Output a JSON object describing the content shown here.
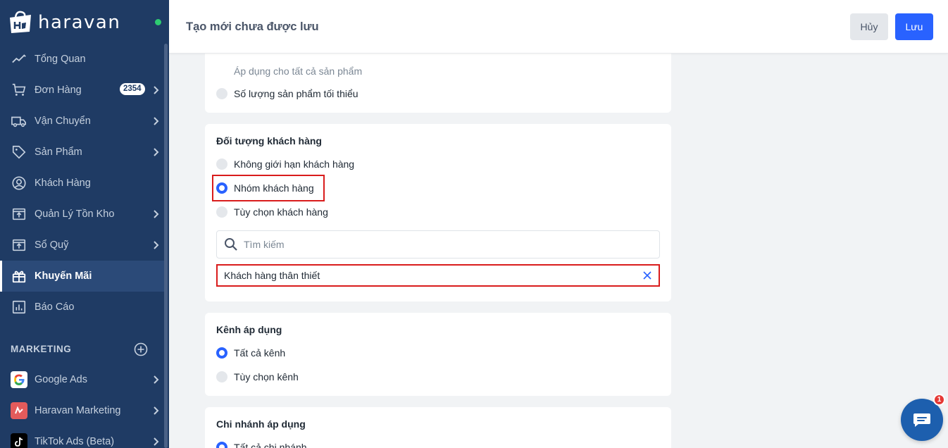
{
  "app": {
    "brand": "haravan"
  },
  "sidebar": {
    "items": [
      {
        "label": "Tổng Quan",
        "icon": "chart-line-icon"
      },
      {
        "label": "Đơn Hàng",
        "icon": "cart-icon",
        "badge": "2354",
        "has_children": true
      },
      {
        "label": "Vận Chuyển",
        "icon": "truck-icon",
        "has_children": true
      },
      {
        "label": "Sản Phẩm",
        "icon": "tag-icon",
        "has_children": true
      },
      {
        "label": "Khách Hàng",
        "icon": "user-circle-icon"
      },
      {
        "label": "Quản Lý Tồn Kho",
        "icon": "inventory-box-icon",
        "has_children": true
      },
      {
        "label": "Sổ Quỹ",
        "icon": "cashbook-icon",
        "has_children": true
      },
      {
        "label": "Khuyến Mãi",
        "icon": "gift-icon",
        "active": true
      },
      {
        "label": "Báo Cáo",
        "icon": "report-icon"
      }
    ],
    "marketing_label": "MARKETING",
    "marketing_items": [
      {
        "label": "Google Ads",
        "icon": "google-icon"
      },
      {
        "label": "Haravan Marketing",
        "icon": "haravan-marketing-icon"
      },
      {
        "label": "TikTok Ads (Beta)",
        "icon": "tiktok-icon"
      }
    ]
  },
  "header": {
    "title": "Tạo mới chưa được lưu",
    "cancel_label": "Hủy",
    "save_label": "Lưu"
  },
  "product_requirement": {
    "helper_text": "Áp dụng cho tất cả sản phẩm",
    "min_quantity_label": "Số lượng sản phẩm tối thiểu"
  },
  "customer_target": {
    "title": "Đối tượng khách hàng",
    "options": [
      {
        "label": "Không giới hạn khách hàng",
        "checked": false
      },
      {
        "label": "Nhóm khách hàng",
        "checked": true
      },
      {
        "label": "Tùy chọn khách hàng",
        "checked": false
      }
    ],
    "search_placeholder": "Tìm kiếm",
    "selected_group": "Khách hàng thân thiết"
  },
  "channels": {
    "title": "Kênh áp dụng",
    "options": [
      {
        "label": "Tất cả kênh",
        "checked": true
      },
      {
        "label": "Tùy chọn kênh",
        "checked": false
      }
    ]
  },
  "branches": {
    "title": "Chi nhánh áp dụng",
    "options": [
      {
        "label": "Tất cả chi nhánh",
        "checked": true
      }
    ]
  },
  "chat": {
    "unread_count": "1"
  },
  "colors": {
    "sidebar_bg": "#1f3b64",
    "primary": "#2962ff",
    "highlight": "#d91c1c"
  }
}
